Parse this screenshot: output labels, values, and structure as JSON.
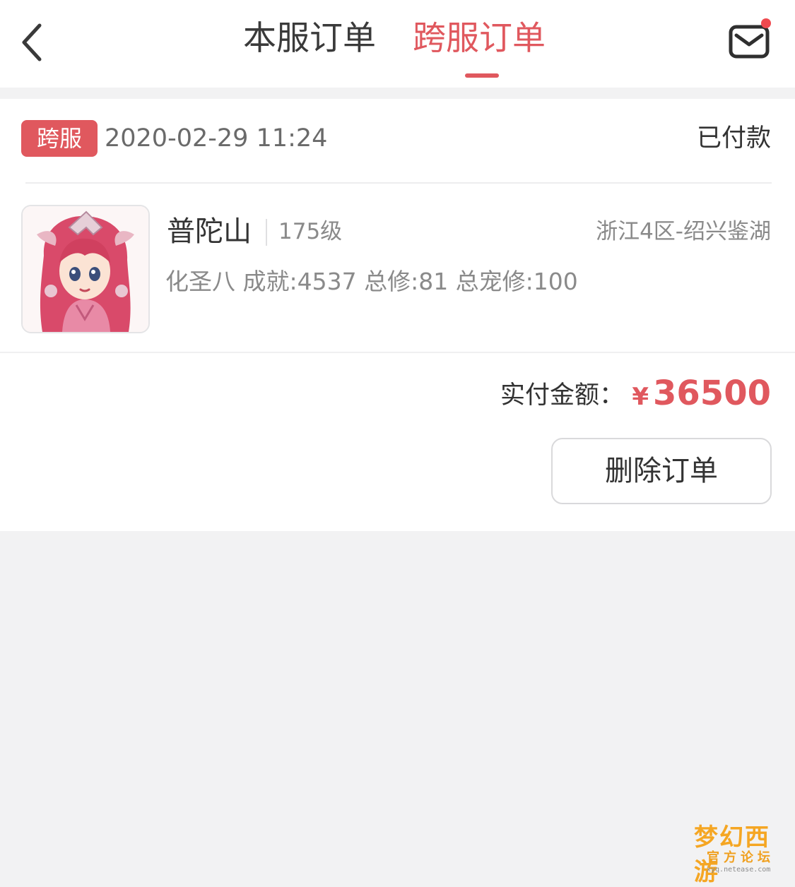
{
  "nav": {
    "tabs": [
      {
        "label": "本服订单",
        "active": false
      },
      {
        "label": "跨服订单",
        "active": true
      }
    ],
    "back_icon": "chevron-left-icon",
    "mail_icon": "mail-icon",
    "has_unread": true
  },
  "order": {
    "badge": "跨服",
    "time": "2020-02-29 11:24",
    "status": "已付款",
    "role": {
      "name": "普陀山",
      "level": "175级",
      "server": "浙江4区-绍兴鉴湖",
      "stats": "化圣八 成就:4537 总修:81 总宠修:100"
    },
    "payment": {
      "label": "实付金额：",
      "currency": "¥",
      "amount": "36500"
    },
    "delete_label": "删除订单"
  },
  "watermark": {
    "logo": "梦幻西游",
    "sub": "官方论坛",
    "url": "xyq.netease.com"
  },
  "colors": {
    "accent": "#e0585e",
    "background": "#f2f2f3",
    "card": "#ffffff",
    "secondary_text": "#8a8a8a"
  }
}
